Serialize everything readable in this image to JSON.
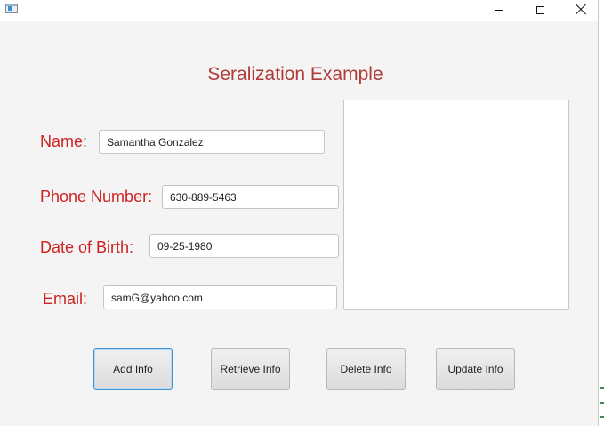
{
  "window": {
    "title_text": "",
    "controls": {
      "minimize": "minimize",
      "maximize": "maximize",
      "close": "close"
    }
  },
  "form": {
    "title": "Seralization Example",
    "fields": {
      "name": {
        "label": "Name:",
        "value": "Samantha Gonzalez"
      },
      "phone": {
        "label": "Phone Number:",
        "value": "630-889-5463"
      },
      "dob": {
        "label": "Date of Birth:",
        "value": "09-25-1980"
      },
      "email": {
        "label": "Email:",
        "value": "samG@yahoo.com"
      }
    },
    "output_text": ""
  },
  "buttons": {
    "add": "Add Info",
    "retrieve": "Retrieve Info",
    "delete": "Delete Info",
    "update": "Update Info"
  },
  "colors": {
    "label": "#cc2222",
    "title": "#b03a3a",
    "background": "#f4f4f4",
    "focus": "#3f94d6"
  }
}
